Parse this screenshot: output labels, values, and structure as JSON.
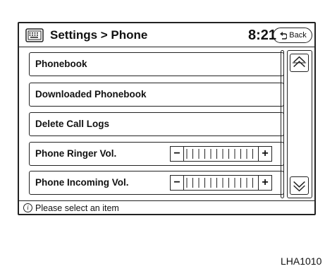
{
  "titlebar": {
    "keyboard_icon": "keyboard-icon",
    "title": "Settings > Phone",
    "time": "8:21",
    "back_label": "Back",
    "back_icon": "back-arrow-icon"
  },
  "list": {
    "items": [
      {
        "label": "Phonebook"
      },
      {
        "label": "Downloaded Phonebook"
      },
      {
        "label": "Delete Call Logs"
      },
      {
        "label": "Phone Ringer Vol.",
        "minus": "−",
        "plus": "+"
      },
      {
        "label": "Phone Incoming Vol.",
        "minus": "−",
        "plus": "+"
      }
    ]
  },
  "scroll": {
    "up_icon": "scroll-up-icon",
    "down_icon": "scroll-down-icon"
  },
  "status": {
    "info_glyph": "i",
    "text": "Please select an item"
  },
  "figure_code": "LHA1010"
}
